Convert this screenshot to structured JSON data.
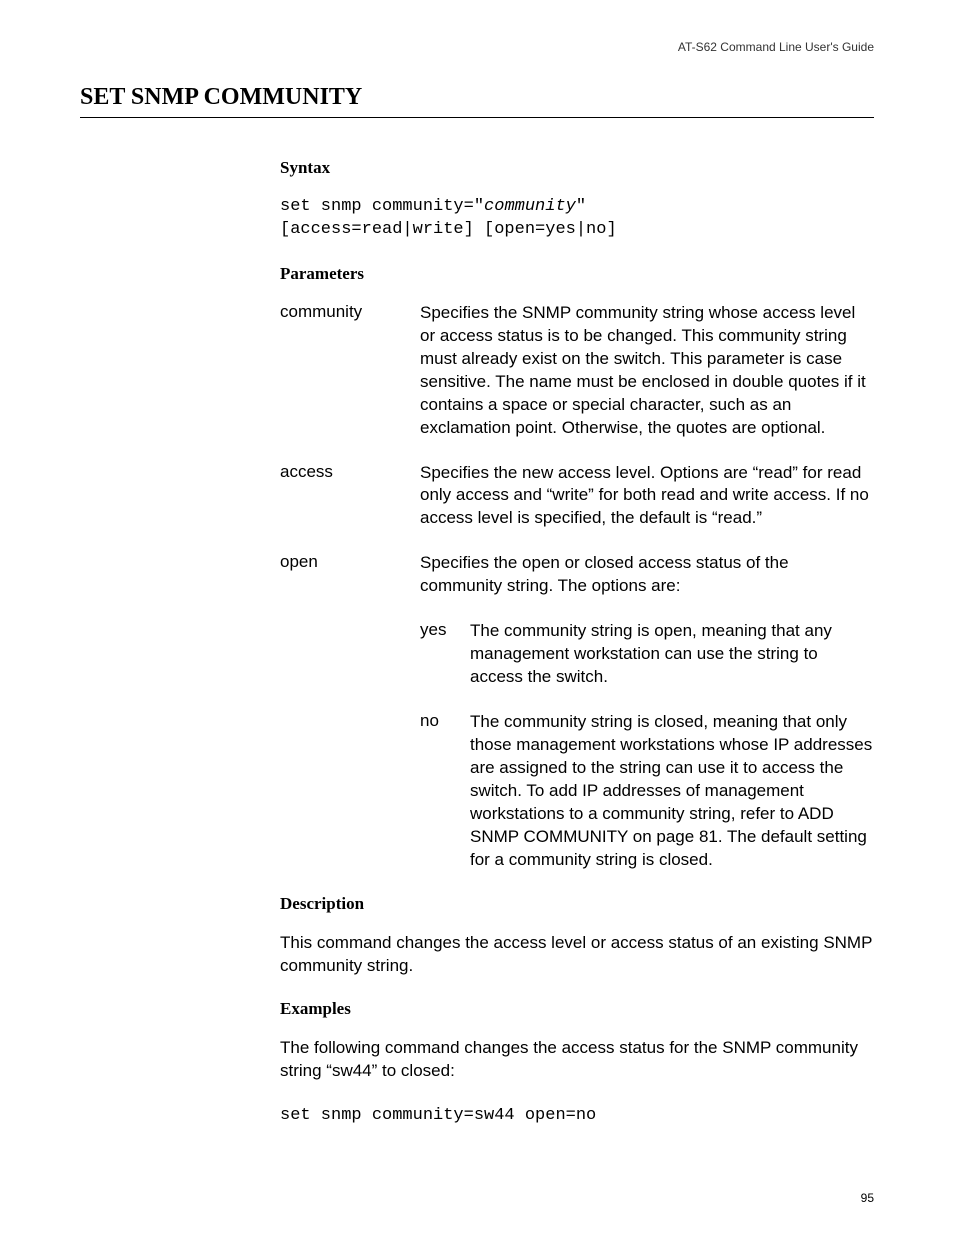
{
  "header": {
    "guide_title": "AT-S62 Command Line User's Guide"
  },
  "title": "SET SNMP COMMUNITY",
  "syntax": {
    "heading": "Syntax",
    "line1_pre": "set snmp community=\"",
    "line1_italic": "community",
    "line1_post": "\"",
    "line2": "[access=read|write] [open=yes|no]"
  },
  "parameters": {
    "heading": "Parameters",
    "items": [
      {
        "name": "community",
        "desc": "Specifies the SNMP community string whose access level or access status is to be changed. This community string must already exist on the switch. This parameter is case sensitive. The name must be enclosed in double quotes if it contains a space or special character, such as an exclamation point. Otherwise, the quotes are optional."
      },
      {
        "name": "access",
        "desc": "Specifies the new access level. Options are “read” for read only access and “write” for both read and write access. If no access level is specified, the default is “read.”"
      },
      {
        "name": "open",
        "desc": "Specifies the open or closed access status of the community string. The options are:"
      }
    ],
    "open_options": [
      {
        "name": "yes",
        "desc": "The community string is open, meaning that any management workstation can use the string to access the switch."
      },
      {
        "name": "no",
        "desc": "The community string is closed, meaning that only those management workstations whose IP addresses are assigned to the string can use it to access the switch. To add IP addresses of management workstations to a community string, refer to ADD SNMP COMMUNITY on page 81. The default setting for a community string is closed."
      }
    ]
  },
  "description": {
    "heading": "Description",
    "text": "This command changes the access level or access status of an existing SNMP community string."
  },
  "examples": {
    "heading": "Examples",
    "intro": "The following command changes the access status for the SNMP community string “sw44” to closed:",
    "code": "set snmp community=sw44 open=no"
  },
  "page_number": "95"
}
